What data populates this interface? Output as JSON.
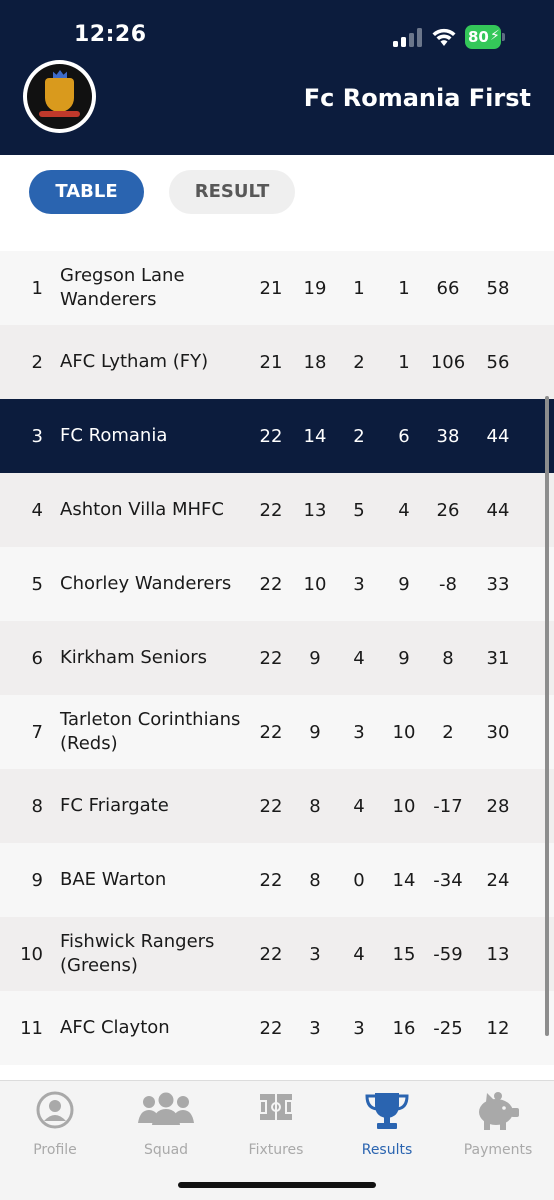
{
  "status_bar": {
    "time": "12:26",
    "battery": "80"
  },
  "header": {
    "team_name": "Fc Romania First"
  },
  "tabs": [
    {
      "label": "TABLE",
      "active": true
    },
    {
      "label": "RESULT",
      "active": false
    }
  ],
  "standings": [
    {
      "pos": "1",
      "team": "Gregson Lane Wanderers",
      "p": "21",
      "w": "19",
      "d": "1",
      "l": "1",
      "gd": "66",
      "pts": "58"
    },
    {
      "pos": "2",
      "team": "AFC Lytham (FY)",
      "p": "21",
      "w": "18",
      "d": "2",
      "l": "1",
      "gd": "106",
      "pts": "56"
    },
    {
      "pos": "3",
      "team": "FC Romania",
      "p": "22",
      "w": "14",
      "d": "2",
      "l": "6",
      "gd": "38",
      "pts": "44",
      "highlight": true
    },
    {
      "pos": "4",
      "team": "Ashton Villa MHFC",
      "p": "22",
      "w": "13",
      "d": "5",
      "l": "4",
      "gd": "26",
      "pts": "44"
    },
    {
      "pos": "5",
      "team": "Chorley Wanderers",
      "p": "22",
      "w": "10",
      "d": "3",
      "l": "9",
      "gd": "-8",
      "pts": "33"
    },
    {
      "pos": "6",
      "team": "Kirkham Seniors",
      "p": "22",
      "w": "9",
      "d": "4",
      "l": "9",
      "gd": "8",
      "pts": "31"
    },
    {
      "pos": "7",
      "team": "Tarleton Corinthians (Reds)",
      "p": "22",
      "w": "9",
      "d": "3",
      "l": "10",
      "gd": "2",
      "pts": "30"
    },
    {
      "pos": "8",
      "team": "FC Friargate",
      "p": "22",
      "w": "8",
      "d": "4",
      "l": "10",
      "gd": "-17",
      "pts": "28"
    },
    {
      "pos": "9",
      "team": "BAE Warton",
      "p": "22",
      "w": "8",
      "d": "0",
      "l": "14",
      "gd": "-34",
      "pts": "24"
    },
    {
      "pos": "10",
      "team": "Fishwick Rangers (Greens)",
      "p": "22",
      "w": "3",
      "d": "4",
      "l": "15",
      "gd": "-59",
      "pts": "13"
    },
    {
      "pos": "11",
      "team": "AFC Clayton",
      "p": "22",
      "w": "3",
      "d": "3",
      "l": "16",
      "gd": "-25",
      "pts": "12"
    }
  ],
  "nav": [
    {
      "label": "Profile",
      "icon": "profile-icon",
      "active": false
    },
    {
      "label": "Squad",
      "icon": "squad-icon",
      "active": false
    },
    {
      "label": "Fixtures",
      "icon": "fixtures-icon",
      "active": false
    },
    {
      "label": "Results",
      "icon": "trophy-icon",
      "active": true
    },
    {
      "label": "Payments",
      "icon": "piggy-bank-icon",
      "active": false
    }
  ],
  "colors": {
    "header_bg": "#0c1c3d",
    "accent": "#2a64b0",
    "highlight_row": "#0c1c3d",
    "inactive_nav": "#a9a9a9"
  }
}
